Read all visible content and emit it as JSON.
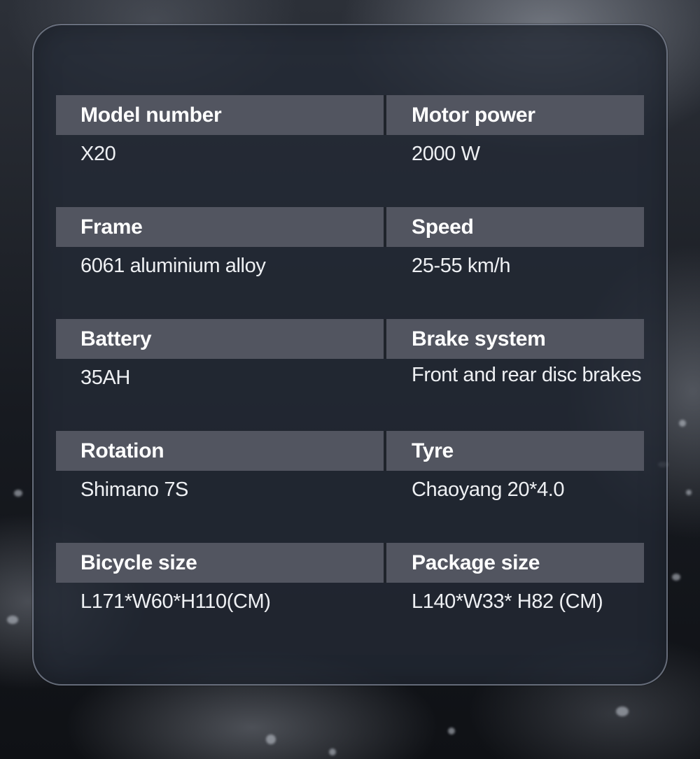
{
  "specs": [
    {
      "left": {
        "label": "Model number",
        "value": "X20"
      },
      "right": {
        "label": "Motor power",
        "value": "2000 W"
      }
    },
    {
      "left": {
        "label": "Frame",
        "value": "6061 aluminium alloy"
      },
      "right": {
        "label": "Speed",
        "value": "25-55 km/h"
      }
    },
    {
      "left": {
        "label": "Battery",
        "value": "35AH"
      },
      "right": {
        "label": "Brake system",
        "value": "Front and rear disc brakes"
      }
    },
    {
      "left": {
        "label": "Rotation",
        "value": "Shimano 7S"
      },
      "right": {
        "label": "Tyre",
        "value": "Chaoyang 20*4.0"
      }
    },
    {
      "left": {
        "label": "Bicycle size",
        "value": "L171*W60*H110(CM)"
      },
      "right": {
        "label": "Package size",
        "value": "L140*W33* H82 (CM)"
      }
    }
  ],
  "colors": {
    "header_bar": "#525560",
    "panel": "#242a36",
    "text": "#ffffff"
  }
}
